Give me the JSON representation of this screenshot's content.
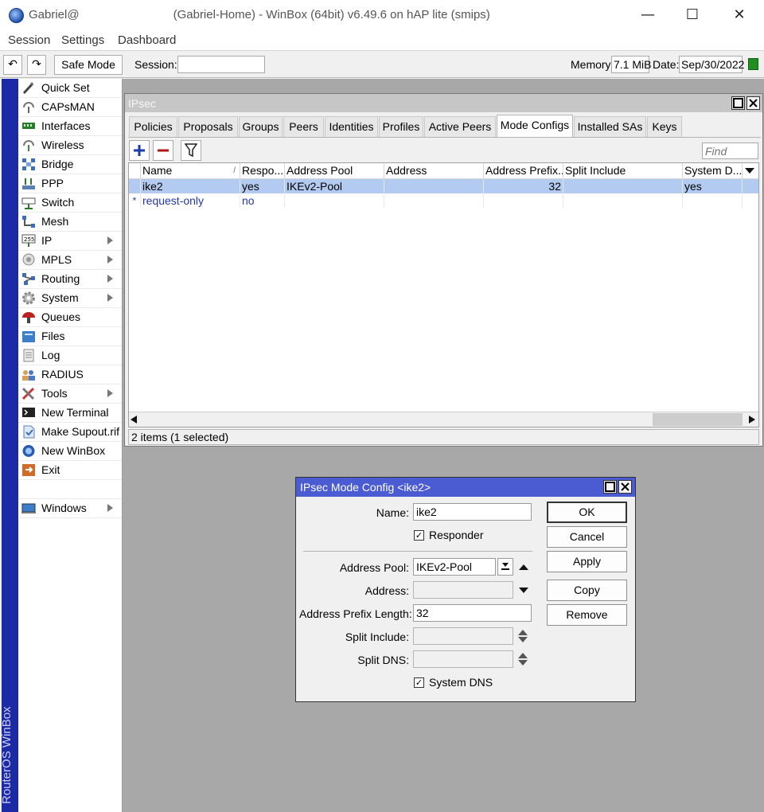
{
  "titlebar": {
    "title_prefix": "Gabriel@",
    "title_suffix": "(Gabriel-Home) - WinBox (64bit) v6.49.6 on hAP lite (smips)",
    "minimize": "—",
    "maximize": "☐",
    "close": "✕"
  },
  "menu": {
    "session": "Session",
    "settings": "Settings",
    "dashboard": "Dashboard"
  },
  "toolbar": {
    "undo_glyph": "↶",
    "redo_glyph": "↷",
    "safe_mode": "Safe Mode",
    "session_label": "Session:",
    "session_value": "",
    "memory_label": "Memory:",
    "memory_value": "7.1 MiB",
    "date_label": "Date:",
    "date_value": "Sep/30/2022"
  },
  "sidebar": {
    "brand": "RouterOS WinBox",
    "items": [
      {
        "label": "Quick Set",
        "icon": "wand-icon"
      },
      {
        "label": "CAPsMAN",
        "icon": "antenna-icon"
      },
      {
        "label": "Interfaces",
        "icon": "interfaces-icon"
      },
      {
        "label": "Wireless",
        "icon": "wireless-icon"
      },
      {
        "label": "Bridge",
        "icon": "bridge-icon"
      },
      {
        "label": "PPP",
        "icon": "ppp-icon"
      },
      {
        "label": "Switch",
        "icon": "switch-icon"
      },
      {
        "label": "Mesh",
        "icon": "mesh-icon"
      },
      {
        "label": "IP",
        "icon": "ip-icon"
      },
      {
        "label": "MPLS",
        "icon": "mpls-icon"
      },
      {
        "label": "Routing",
        "icon": "routing-icon"
      },
      {
        "label": "System",
        "icon": "gear-icon"
      },
      {
        "label": "Queues",
        "icon": "queues-icon"
      },
      {
        "label": "Files",
        "icon": "folder-icon"
      },
      {
        "label": "Log",
        "icon": "log-icon"
      },
      {
        "label": "RADIUS",
        "icon": "users-icon"
      },
      {
        "label": "Tools",
        "icon": "tools-icon"
      },
      {
        "label": "New Terminal",
        "icon": "terminal-icon"
      },
      {
        "label": "Make Supout.rif",
        "icon": "supout-icon"
      },
      {
        "label": "New WinBox",
        "icon": "winbox-icon"
      },
      {
        "label": "Exit",
        "icon": "exit-icon"
      },
      {
        "label": "Windows",
        "icon": "windows-icon"
      }
    ]
  },
  "ipsec": {
    "title": "IPsec",
    "tabs": [
      "Policies",
      "Proposals",
      "Groups",
      "Peers",
      "Identities",
      "Profiles",
      "Active Peers",
      "Mode Configs",
      "Installed SAs",
      "Keys"
    ],
    "active_tab": "Mode Configs",
    "find_placeholder": "Find",
    "columns": [
      "Name",
      "Respo...",
      "Address Pool",
      "Address",
      "Address Prefix...",
      "Split Include",
      "System D..."
    ],
    "rows": [
      {
        "marker": "",
        "name": "ike2",
        "responder": "yes",
        "pool": "IKEv2-Pool",
        "address": "",
        "prefix": "32",
        "split": "",
        "sysdns": "yes"
      },
      {
        "marker": "*",
        "name": "request-only",
        "responder": "no",
        "pool": "",
        "address": "",
        "prefix": "",
        "split": "",
        "sysdns": ""
      }
    ],
    "status": "2 items (1 selected)"
  },
  "dialog": {
    "title": "IPsec Mode Config <ike2>",
    "name_label": "Name:",
    "name_value": "ike2",
    "responder_label": "Responder",
    "pool_label": "Address Pool:",
    "pool_value": "IKEv2-Pool",
    "address_label": "Address:",
    "prefix_label": "Address Prefix Length:",
    "prefix_value": "32",
    "split_include_label": "Split Include:",
    "split_dns_label": "Split DNS:",
    "system_dns_label": "System DNS",
    "buttons": {
      "ok": "OK",
      "cancel": "Cancel",
      "apply": "Apply",
      "copy": "Copy",
      "remove": "Remove"
    }
  },
  "colors": {
    "dialog_title": "#4b5bd1",
    "selected_row": "#b3cbf0",
    "sidebar_bar": "#1c2aa6",
    "status_green": "#1f8f1f"
  }
}
